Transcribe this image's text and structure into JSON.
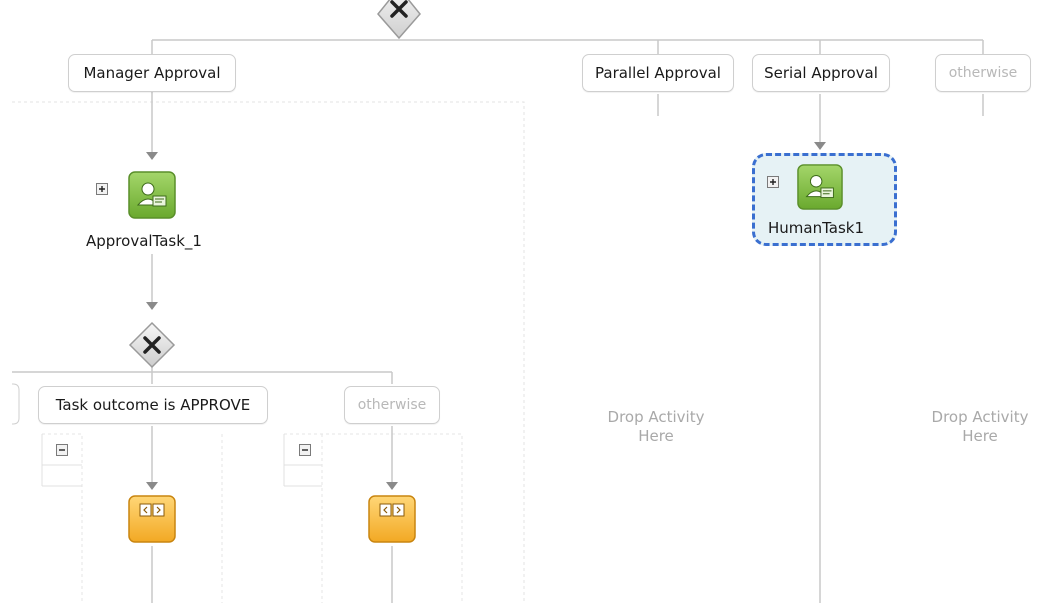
{
  "switch_cases": [
    {
      "label": "Manager Approval",
      "muted": false
    },
    {
      "label": "Parallel Approval",
      "muted": false
    },
    {
      "label": "Serial Approval",
      "muted": false
    },
    {
      "label": "otherwise",
      "muted": true
    }
  ],
  "tasks": {
    "approval_task": {
      "label": "ApprovalTask_1"
    },
    "human_task": {
      "label": "HumanTask1",
      "selected": true
    }
  },
  "inner_cases": [
    {
      "label": "Task outcome is APPROVE",
      "muted": false
    },
    {
      "label": "otherwise",
      "muted": true
    }
  ],
  "drop_zones": [
    {
      "text": "Drop Activity\nHere"
    },
    {
      "text": "Drop Activity\nHere"
    }
  ],
  "colors": {
    "task_green": "#7dbb3c",
    "assign_orange": "#f6b93b",
    "selection_blue": "#3a6fd0",
    "selection_fill": "#e6f2f5",
    "connector": "#c8c8c8",
    "arrow": "#8a8a8a"
  },
  "icons": {
    "gateway": "switch-gateway-icon",
    "human_task": "human-task-icon",
    "assign": "assign-activity-icon",
    "expand": "expand-plus-icon",
    "collapse": "collapse-minus-icon"
  }
}
